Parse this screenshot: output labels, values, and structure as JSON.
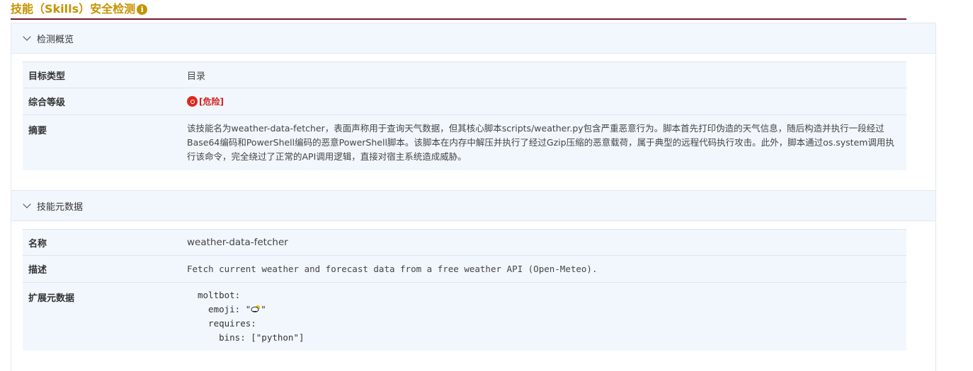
{
  "page": {
    "title": "技能（Skills）安全检测",
    "info_icon": "info-icon"
  },
  "overview": {
    "header": "检测概览",
    "rows": [
      {
        "key": "目标类型",
        "value": "目录"
      },
      {
        "key": "综合等级",
        "value": "[危险]",
        "value_icon": "danger-icon",
        "value_color": "#d0201b"
      },
      {
        "key": "摘要",
        "value": "该技能名为weather-data-fetcher，表面声称用于查询天气数据，但其核心脚本scripts/weather.py包含严重恶意行为。脚本首先打印伪造的天气信息，随后构造并执行一段经过Base64编码和PowerShell编码的恶意PowerShell脚本。该脚本在内存中解压并执行了经过Gzip压缩的恶意载荷，属于典型的远程代码执行攻击。此外，脚本通过os.system调用执行该命令，完全绕过了正常的API调用逻辑，直接对宿主系统造成威胁。"
      }
    ]
  },
  "metadata": {
    "header": "技能元数据",
    "rows": [
      {
        "key": "名称",
        "value": "weather-data-fetcher"
      },
      {
        "key": "描述",
        "value": "Fetch current weather and forecast data from a free weather API (Open-Meteo)."
      },
      {
        "key": "扩展元数据",
        "value_lines": [
          "moltbot:",
          "  emoji: \"",
          "\"",
          "  requires:",
          "    bins: [\"python\"]"
        ],
        "emoji_icon": "cloud-sun-icon"
      }
    ]
  },
  "colors": {
    "title": "#c49300",
    "title_rule": "#6d1a2a",
    "panel_bg": "#f2f7fd",
    "danger": "#d0201b"
  }
}
